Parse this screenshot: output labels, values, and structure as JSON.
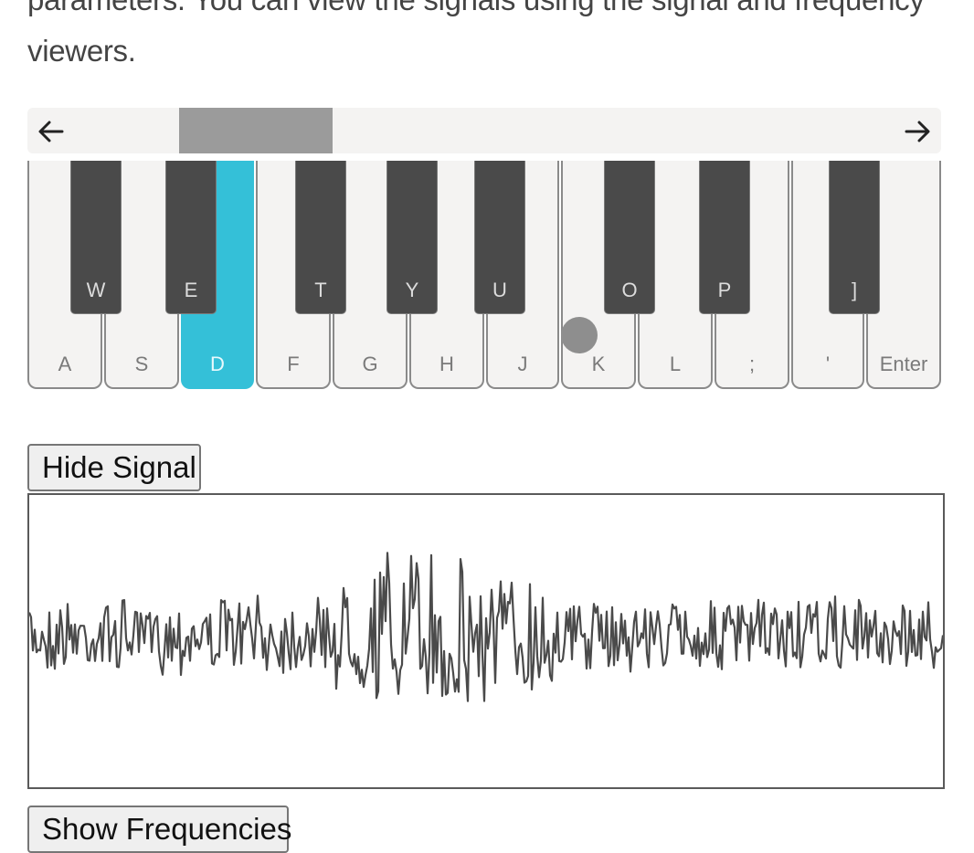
{
  "intro": {
    "line1": "parameters. You can view the signals using the signal and frequency",
    "line2": "viewers."
  },
  "scroll": {
    "left_icon": "arrow-left-icon",
    "right_icon": "arrow-right-icon",
    "thumb_color": "#9b9b9b"
  },
  "keyboard": {
    "white_keys": [
      "A",
      "S",
      "D",
      "F",
      "G",
      "H",
      "J",
      "K",
      "L",
      ";",
      "'",
      "Enter"
    ],
    "black_keys": [
      "W",
      "E",
      "T",
      "Y",
      "U",
      "O",
      "P",
      "]"
    ],
    "active_key": "D",
    "active_color": "#34c0d8"
  },
  "buttons": {
    "hide_signal": "Hide Signal",
    "show_frequencies": "Show Frequencies"
  },
  "signal": {
    "color": "#4a4a4a"
  }
}
